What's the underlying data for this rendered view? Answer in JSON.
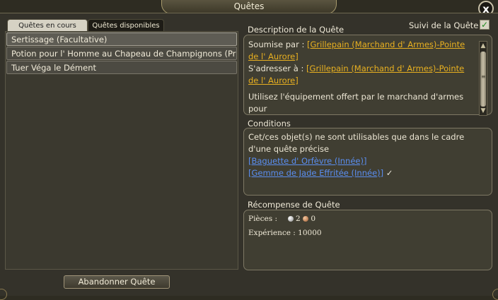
{
  "window": {
    "title": "Quêtes",
    "close_label": "x"
  },
  "tabs": [
    {
      "label": "Quêtes en cours",
      "active": true
    },
    {
      "label": "Quêtes disponibles",
      "active": false
    }
  ],
  "quest_list": [
    {
      "label": "Sertissage (Facultative)",
      "selected": true
    },
    {
      "label": "Potion pour l' Homme au Chapeau de Champignons (Prir",
      "selected": false
    },
    {
      "label": "Tuer Véga le Dément",
      "selected": false
    }
  ],
  "abandon_button": "Abandonner Quête",
  "tracking": {
    "label": "Suivi de la Quête",
    "checked": true
  },
  "description": {
    "header": "Description de la Quête",
    "submitted_by_label": "Soumise par :",
    "submitted_by_link": "[Grillepain (Marchand d' Armes)-Pointe de l' Aurore]",
    "contact_label": "S'adresser à :",
    "contact_link": "[Grillepain (Marchand d' Armes)-Pointe de l' Aurore]",
    "body": "Utilisez l'équipement offert par le marchand d'armes pour"
  },
  "conditions": {
    "header": "Conditions",
    "text": "Cet/ces objet(s) ne sont utilisables que dans le cadre d'une quête précise",
    "items": [
      {
        "label": "[Baguette d' Orfèvre (Innée)]",
        "done": false
      },
      {
        "label": "[Gemme de Jade Effritée (Innée)]",
        "done": true
      }
    ],
    "check_mark": "✓"
  },
  "reward": {
    "header": "Récompense de Quête",
    "coins_label": "Pièces :",
    "silver": "2",
    "copper": "0",
    "experience_label": "Expérience : 10000"
  },
  "colors": {
    "gold_link": "#e8b020",
    "blue_link": "#5a8ef0",
    "panel_bg": "#403e32"
  }
}
